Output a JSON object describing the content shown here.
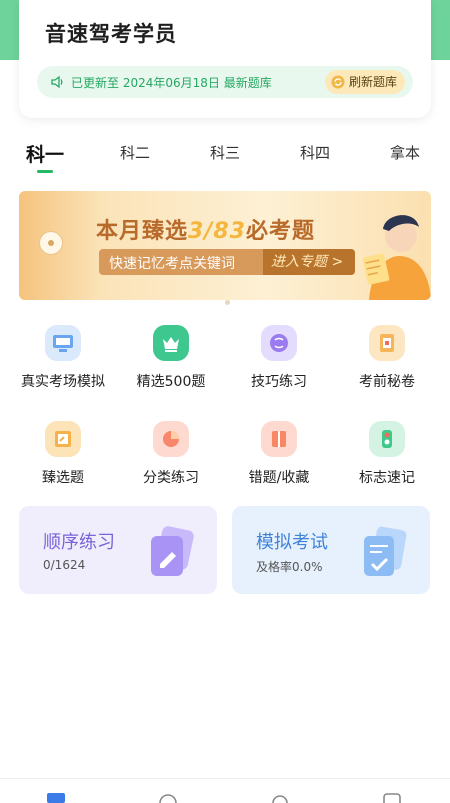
{
  "header": {
    "title": "音速驾考学员",
    "update_text": "已更新至 2024年06月18日 最新题库",
    "refresh_label": "刷新题库"
  },
  "tabs": [
    {
      "label": "科一",
      "active": true
    },
    {
      "label": "科二",
      "active": false
    },
    {
      "label": "科三",
      "active": false
    },
    {
      "label": "科四",
      "active": false
    },
    {
      "label": "拿本",
      "active": false
    }
  ],
  "banner": {
    "headline_prefix": "本月臻选",
    "headline_number": "3/83",
    "headline_suffix": "必考题",
    "subline": "快速记忆考点关键词",
    "cta": "进入专题 >"
  },
  "features": [
    {
      "label": "真实考场模拟",
      "icon": "monitor-icon",
      "color": "#6aa6ef"
    },
    {
      "label": "精选500题",
      "icon": "crown-icon",
      "color": "#3fc790"
    },
    {
      "label": "技巧练习",
      "icon": "brain-icon",
      "color": "#9b7bf0"
    },
    {
      "label": "考前秘卷",
      "icon": "scroll-icon",
      "color": "#f7b55a"
    },
    {
      "label": "臻选题",
      "icon": "document-icon",
      "color": "#f6b248"
    },
    {
      "label": "分类练习",
      "icon": "pie-chart-icon",
      "color": "#f7866a"
    },
    {
      "label": "错题/收藏",
      "icon": "book-icon",
      "color": "#f78863"
    },
    {
      "label": "标志速记",
      "icon": "traffic-light-icon",
      "color": "#3ec88c"
    }
  ],
  "cards": {
    "sequential": {
      "title": "顺序练习",
      "sub": "0/1624"
    },
    "mock": {
      "title": "模拟考试",
      "sub": "及格率0.0%"
    }
  },
  "colors": {
    "brand_green": "#25b865",
    "accent_yellow": "#fce8b9"
  }
}
